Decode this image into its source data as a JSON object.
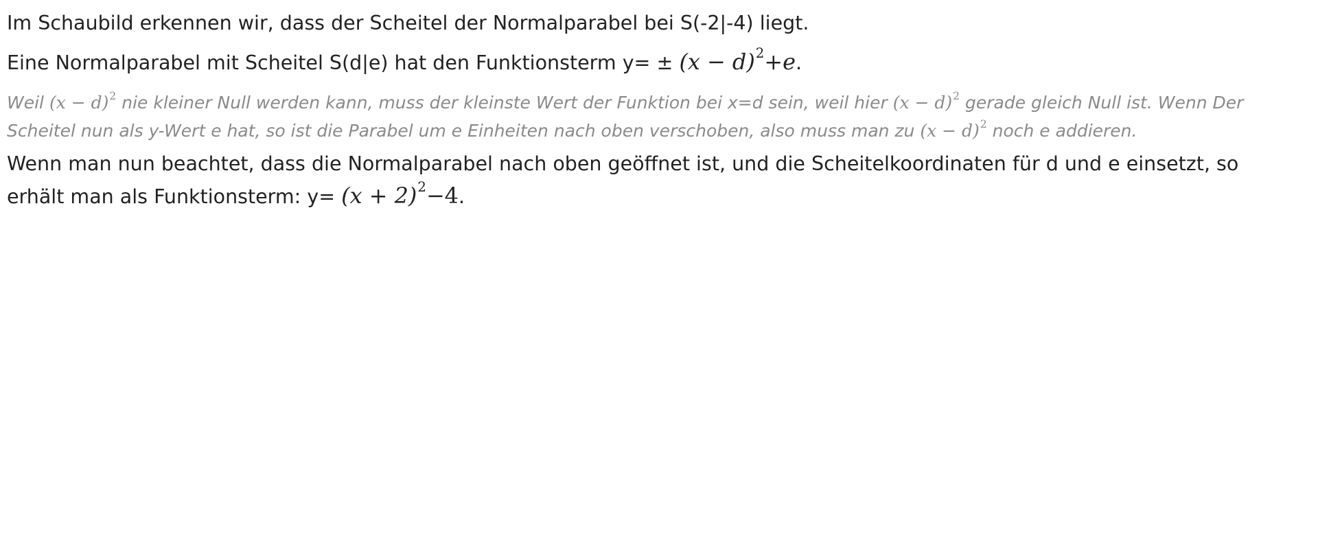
{
  "doc": {
    "p1": "Im Schaubild erkennen wir, dass der Scheitel der Normalparabel bei S(-2|-4) liegt.",
    "p2": {
      "text": "Eine Normalparabel mit Scheitel S(d|e) hat den Funktionsterm y= ± ",
      "math_base": "(x − d)",
      "math_exp": "2",
      "math_tail": "+e",
      "end": "."
    },
    "note": {
      "t1": "Weil ",
      "m1_base": "(x − d)",
      "m1_exp": "2",
      "t2": " nie kleiner Null werden kann, muss der kleinste Wert der Funktion bei x=d sein, weil hier ",
      "m2_base": "(x − d)",
      "m2_exp": "2",
      "t3": " gerade gleich Null ist. Wenn Der Scheitel nun als y-Wert e hat, so ist die Parabel um e Einheiten nach oben verschoben, also muss man zu ",
      "m3_base": "(x − d)",
      "m3_exp": "2",
      "t4": " noch e addieren."
    },
    "p3": {
      "text": "Wenn man nun beachtet, dass die Normalparabel nach oben geöffnet ist, und die Scheitelkoordinaten für d und e einsetzt, so erhält man als Funktionsterm: y= ",
      "math_base": "(x + 2)",
      "math_exp": "2",
      "math_tail": "−4",
      "end": "."
    }
  }
}
